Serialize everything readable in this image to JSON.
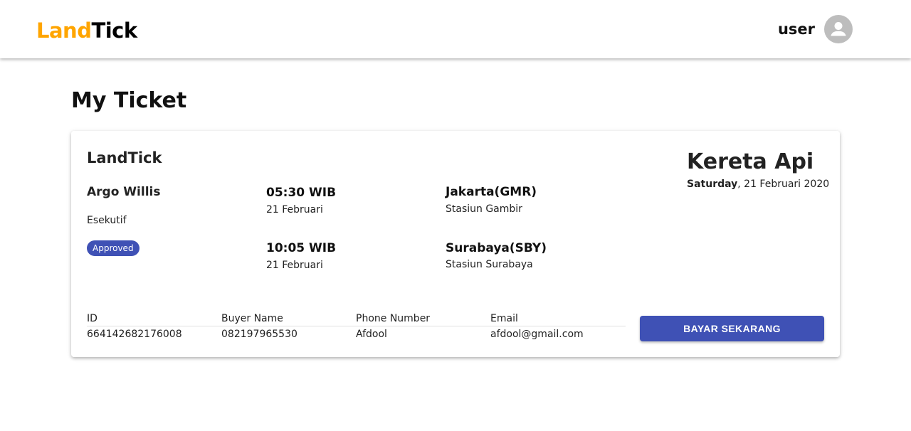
{
  "navbar": {
    "brand_part1": "Land",
    "brand_part2": "Tick",
    "brand_colors": {
      "part1": "#ffa500",
      "part2": "#000000"
    },
    "username": "user",
    "avatar_icon": "account-circle-icon"
  },
  "page": {
    "title": "My Ticket"
  },
  "ticket": {
    "brand": "LandTick",
    "train_name": "Argo Willis",
    "train_class": "Esekutif",
    "status": "Approved",
    "status_color": "#3f51b5",
    "departure": {
      "time": "05:30",
      "zone": "WIB",
      "date": "21 Februari",
      "city": "Jakarta(GMR)",
      "station": "Stasiun Gambir"
    },
    "arrival": {
      "time": "10:05",
      "zone": "WIB",
      "date": "21 Februari",
      "city": "Surabaya(SBY)",
      "station": "Stasiun Surabaya"
    },
    "transport_type": "Kereta Api",
    "day": "Saturday",
    "full_date": ", 21 Februari 2020",
    "columns": [
      "ID",
      "Buyer Name",
      "Phone Number",
      "Email"
    ],
    "values": [
      "664142682176008",
      "082197965530",
      "Afdool",
      "afdool@gmail.com"
    ],
    "pay_button": "BAYAR SEKARANG",
    "pay_button_color": "#3f51b5"
  }
}
